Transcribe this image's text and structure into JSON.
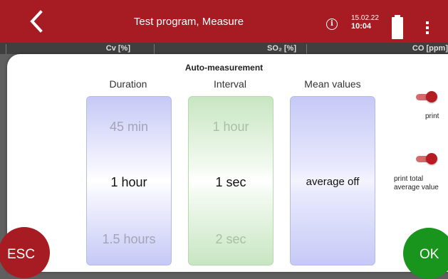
{
  "header": {
    "title": "Test program, Measure",
    "date": "15.02.22",
    "time": "10:04",
    "icons": [
      "back-icon",
      "info-icon",
      "battery-icon",
      "more-vertical-icon"
    ]
  },
  "background_table": {
    "columns": [
      "Cv [%]",
      "SO₂ [%]",
      "CO [ppm]"
    ]
  },
  "dialog": {
    "title": "Auto-measurement",
    "duration": {
      "label": "Duration",
      "prev": "45 min",
      "value": "1 hour",
      "next": "1.5 hours"
    },
    "interval": {
      "label": "Interval",
      "prev": "1 hour",
      "value": "1 sec",
      "next": "2 sec"
    },
    "mean": {
      "label": "Mean values",
      "value": "average off"
    },
    "options": [
      {
        "label": "print",
        "on": true
      },
      {
        "label_line1": "print total",
        "label_line2": "average value",
        "on": true
      }
    ],
    "esc_label": "ESC",
    "ok_label": "OK"
  },
  "colors": {
    "brand_red": "#a61c22",
    "ok_green": "#19941c",
    "duration_picker": "#c6c9f6",
    "interval_picker": "#c8e6c2"
  }
}
